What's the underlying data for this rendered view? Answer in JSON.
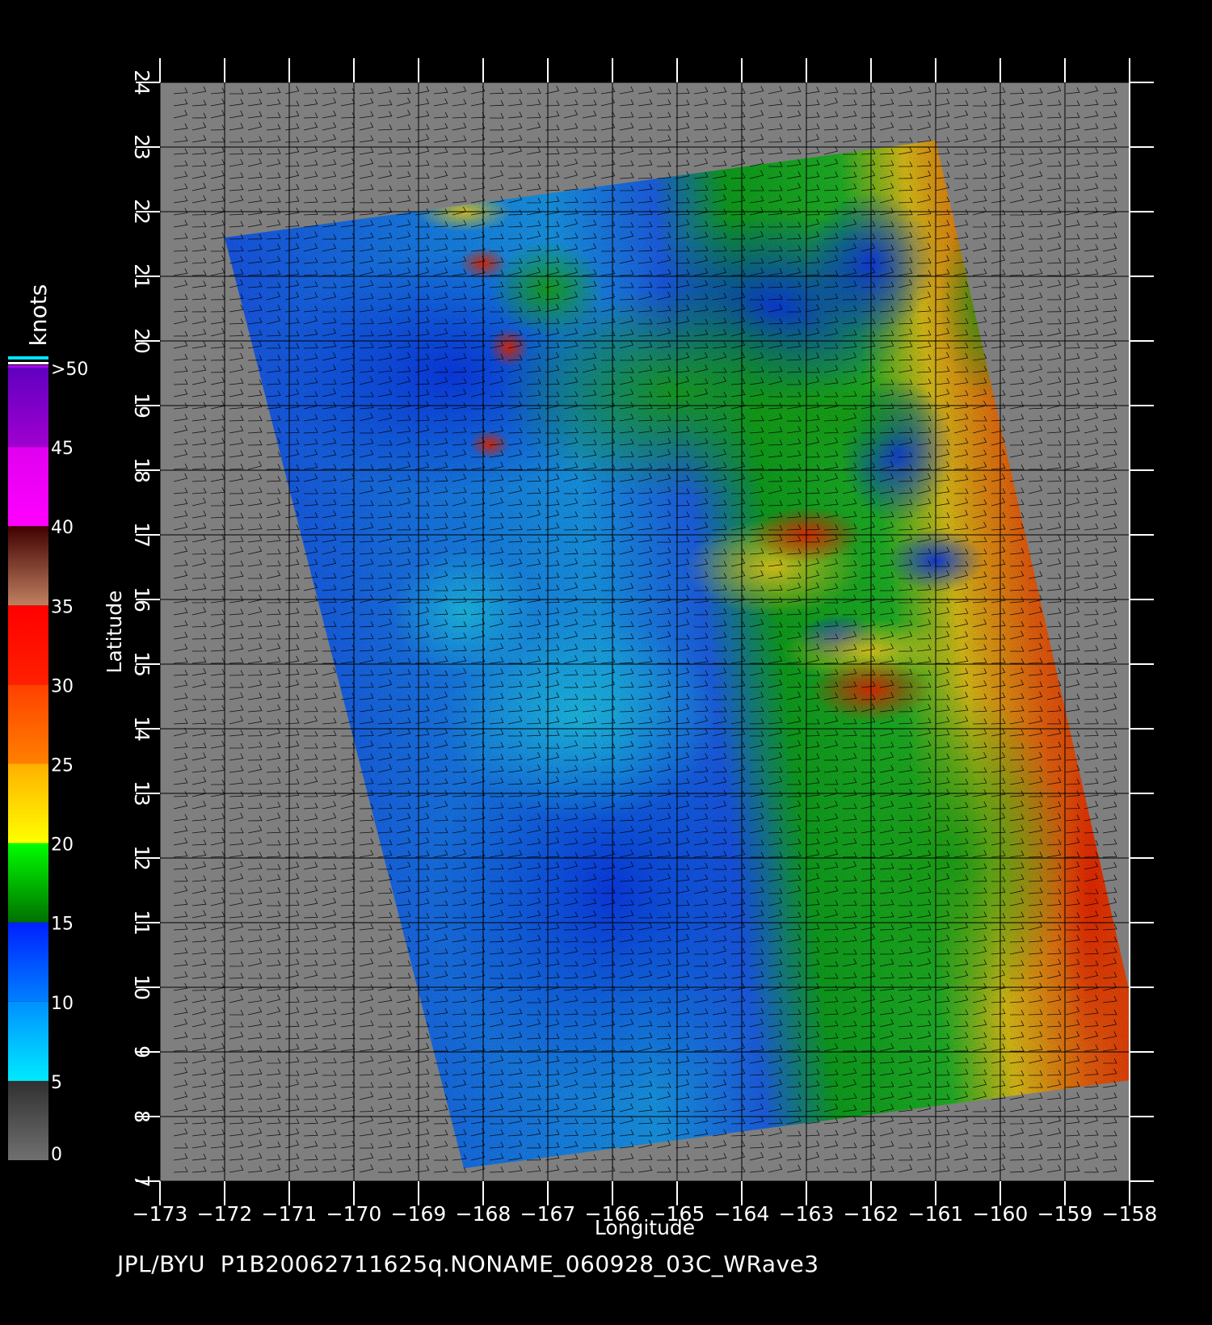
{
  "map": {
    "source_label": "JPL/BYU  P1B20062711625q.NONAME_060928_03C_WRave3",
    "x_axis_title": "Longitude",
    "y_axis_title": "Latitude",
    "lon_range": [
      -173,
      -158
    ],
    "lat_range": [
      7,
      24
    ],
    "lon_ticks": [
      "−173",
      "−172",
      "−171",
      "−170",
      "−169",
      "−168",
      "−167",
      "−166",
      "−165",
      "−164",
      "−163",
      "−162",
      "−161",
      "−160",
      "−159",
      "−158"
    ],
    "lat_ticks": [
      "7",
      "8",
      "9",
      "10",
      "11",
      "12",
      "13",
      "14",
      "15",
      "16",
      "17",
      "18",
      "19",
      "20",
      "21",
      "22",
      "23",
      "24"
    ],
    "background_color": "#7f7f7f",
    "swath_corners_lonlat": [
      [
        -172.0,
        21.6
      ],
      [
        -161.0,
        23.1
      ],
      [
        -157.7,
        8.6
      ],
      [
        -168.3,
        7.2
      ]
    ]
  },
  "legend": {
    "title": "knots",
    "labels": [
      "0",
      "5",
      "10",
      "15",
      "20",
      "25",
      "30",
      "35",
      "40",
      "45",
      ">50"
    ],
    "bands": [
      {
        "from": 0,
        "to": 5,
        "colors": [
          "#707070",
          "#303030"
        ]
      },
      {
        "from": 5,
        "to": 10,
        "colors": [
          "#00eaff",
          "#0090ff"
        ]
      },
      {
        "from": 10,
        "to": 15,
        "colors": [
          "#0080ff",
          "#0020ff"
        ]
      },
      {
        "from": 15,
        "to": 20,
        "colors": [
          "#007000",
          "#00ff00"
        ]
      },
      {
        "from": 20,
        "to": 25,
        "colors": [
          "#ffff00",
          "#ffb000"
        ]
      },
      {
        "from": 25,
        "to": 30,
        "colors": [
          "#ff8000",
          "#ff4000"
        ]
      },
      {
        "from": 30,
        "to": 35,
        "colors": [
          "#ff2000",
          "#ff0000"
        ]
      },
      {
        "from": 35,
        "to": 40,
        "colors": [
          "#c08060",
          "#400000"
        ]
      },
      {
        "from": 40,
        "to": 45,
        "colors": [
          "#ff00ff",
          "#e000f0"
        ]
      },
      {
        "from": 45,
        "to": 50,
        "colors": [
          "#a000d0",
          "#6000c0"
        ]
      }
    ]
  }
}
